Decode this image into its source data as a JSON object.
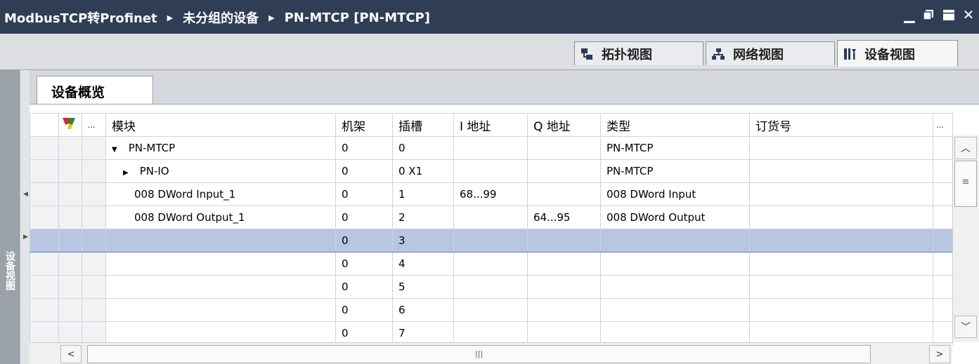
{
  "breadcrumb": {
    "project": "ModbusTCP转Profinet",
    "group": "未分组的设备",
    "device": "PN-MTCP [PN-MTCP]"
  },
  "window_controls": {
    "minimize_icon": "minimize-icon",
    "restore_icon": "restore-icon",
    "maximize_icon": "maximize-icon",
    "close_icon": "close-icon"
  },
  "view_tabs": [
    {
      "label": "拓扑视图",
      "icon": "topology-icon",
      "active": false
    },
    {
      "label": "网络视图",
      "icon": "network-icon",
      "active": false
    },
    {
      "label": "设备视图",
      "icon": "device-icon",
      "active": true
    }
  ],
  "sidebar": {
    "label": "设备视图"
  },
  "overview_tab": {
    "label": "设备概览"
  },
  "table": {
    "headers": {
      "icon": "filter-icon",
      "more": "...",
      "module": "模块",
      "rack": "机架",
      "slot": "插槽",
      "i_addr": "I 地址",
      "q_addr": "Q 地址",
      "type": "类型",
      "order": "订货号",
      "more_right": "..."
    },
    "rows": [
      {
        "module": "PN-MTCP",
        "expander": "▼",
        "rack": "0",
        "slot": "0",
        "i_addr": "",
        "q_addr": "",
        "type": "PN-MTCP",
        "order": "",
        "indent": 1
      },
      {
        "module": "PN-IO",
        "expander": "▶",
        "rack": "0",
        "slot": "0 X1",
        "i_addr": "",
        "q_addr": "",
        "type": "PN-MTCP",
        "order": "",
        "indent": 2
      },
      {
        "module": "008 DWord Input_1",
        "expander": "",
        "rack": "0",
        "slot": "1",
        "i_addr": "68...99",
        "q_addr": "",
        "type": "008 DWord Input",
        "order": "",
        "indent": 1
      },
      {
        "module": "008 DWord Output_1",
        "expander": "",
        "rack": "0",
        "slot": "2",
        "i_addr": "",
        "q_addr": "64...95",
        "type": "008 DWord Output",
        "order": "",
        "indent": 1
      },
      {
        "module": "",
        "expander": "",
        "rack": "0",
        "slot": "3",
        "i_addr": "",
        "q_addr": "",
        "type": "",
        "order": "",
        "indent": 1,
        "selected": true
      },
      {
        "module": "",
        "expander": "",
        "rack": "0",
        "slot": "4",
        "i_addr": "",
        "q_addr": "",
        "type": "",
        "order": "",
        "indent": 1
      },
      {
        "module": "",
        "expander": "",
        "rack": "0",
        "slot": "5",
        "i_addr": "",
        "q_addr": "",
        "type": "",
        "order": "",
        "indent": 1
      },
      {
        "module": "",
        "expander": "",
        "rack": "0",
        "slot": "6",
        "i_addr": "",
        "q_addr": "",
        "type": "",
        "order": "",
        "indent": 1
      },
      {
        "module": "",
        "expander": "",
        "rack": "0",
        "slot": "7",
        "i_addr": "",
        "q_addr": "",
        "type": "",
        "order": "",
        "indent": 1
      }
    ]
  },
  "scrollbar": {
    "h_thumb_grip": "|||",
    "v_thumb_grip": "≡"
  }
}
